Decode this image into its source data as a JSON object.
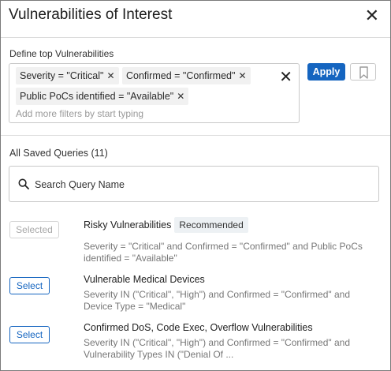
{
  "dialog": {
    "title": "Vulnerabilities of Interest",
    "close_icon": "close-icon"
  },
  "filters": {
    "section_label": "Define top Vulnerabilities",
    "chips": [
      {
        "text": "Severity = \"Critical\""
      },
      {
        "text": "Confirmed = \"Confirmed\""
      },
      {
        "text": "Public PoCs identified = \"Available\""
      }
    ],
    "chip_remove_icon": "close-icon",
    "clear_all_icon": "close-icon",
    "placeholder": "Add more filters by start typing",
    "apply_label": "Apply",
    "bookmark_icon": "bookmark-icon"
  },
  "saved_queries": {
    "label": "All Saved Queries (11)",
    "search_placeholder": "Search Query Name",
    "search_icon": "search-icon",
    "items": [
      {
        "button": "Selected",
        "name": "Risky Vulnerabilities",
        "badge": "Recommended",
        "desc": "Severity = \"Critical\" and Confirmed = \"Confirmed\" and Public PoCs identified = \"Available\""
      },
      {
        "button": "Select",
        "name": "Vulnerable Medical Devices",
        "desc": "Severity IN (\"Critical\", \"High\") and Confirmed = \"Confirmed\" and Device Type = \"Medical\""
      },
      {
        "button": "Select",
        "name": "Confirmed DoS, Code Exec, Overflow Vulnerabilities",
        "desc": "Severity IN (\"Critical\", \"High\") and Confirmed = \"Confirmed\" and Vulnerability Types IN (\"Denial Of ..."
      }
    ]
  },
  "colors": {
    "accent": "#1565c0",
    "chip_bg": "#f1f1f1",
    "badge_bg": "#edf1f4",
    "muted_text": "#777777"
  }
}
